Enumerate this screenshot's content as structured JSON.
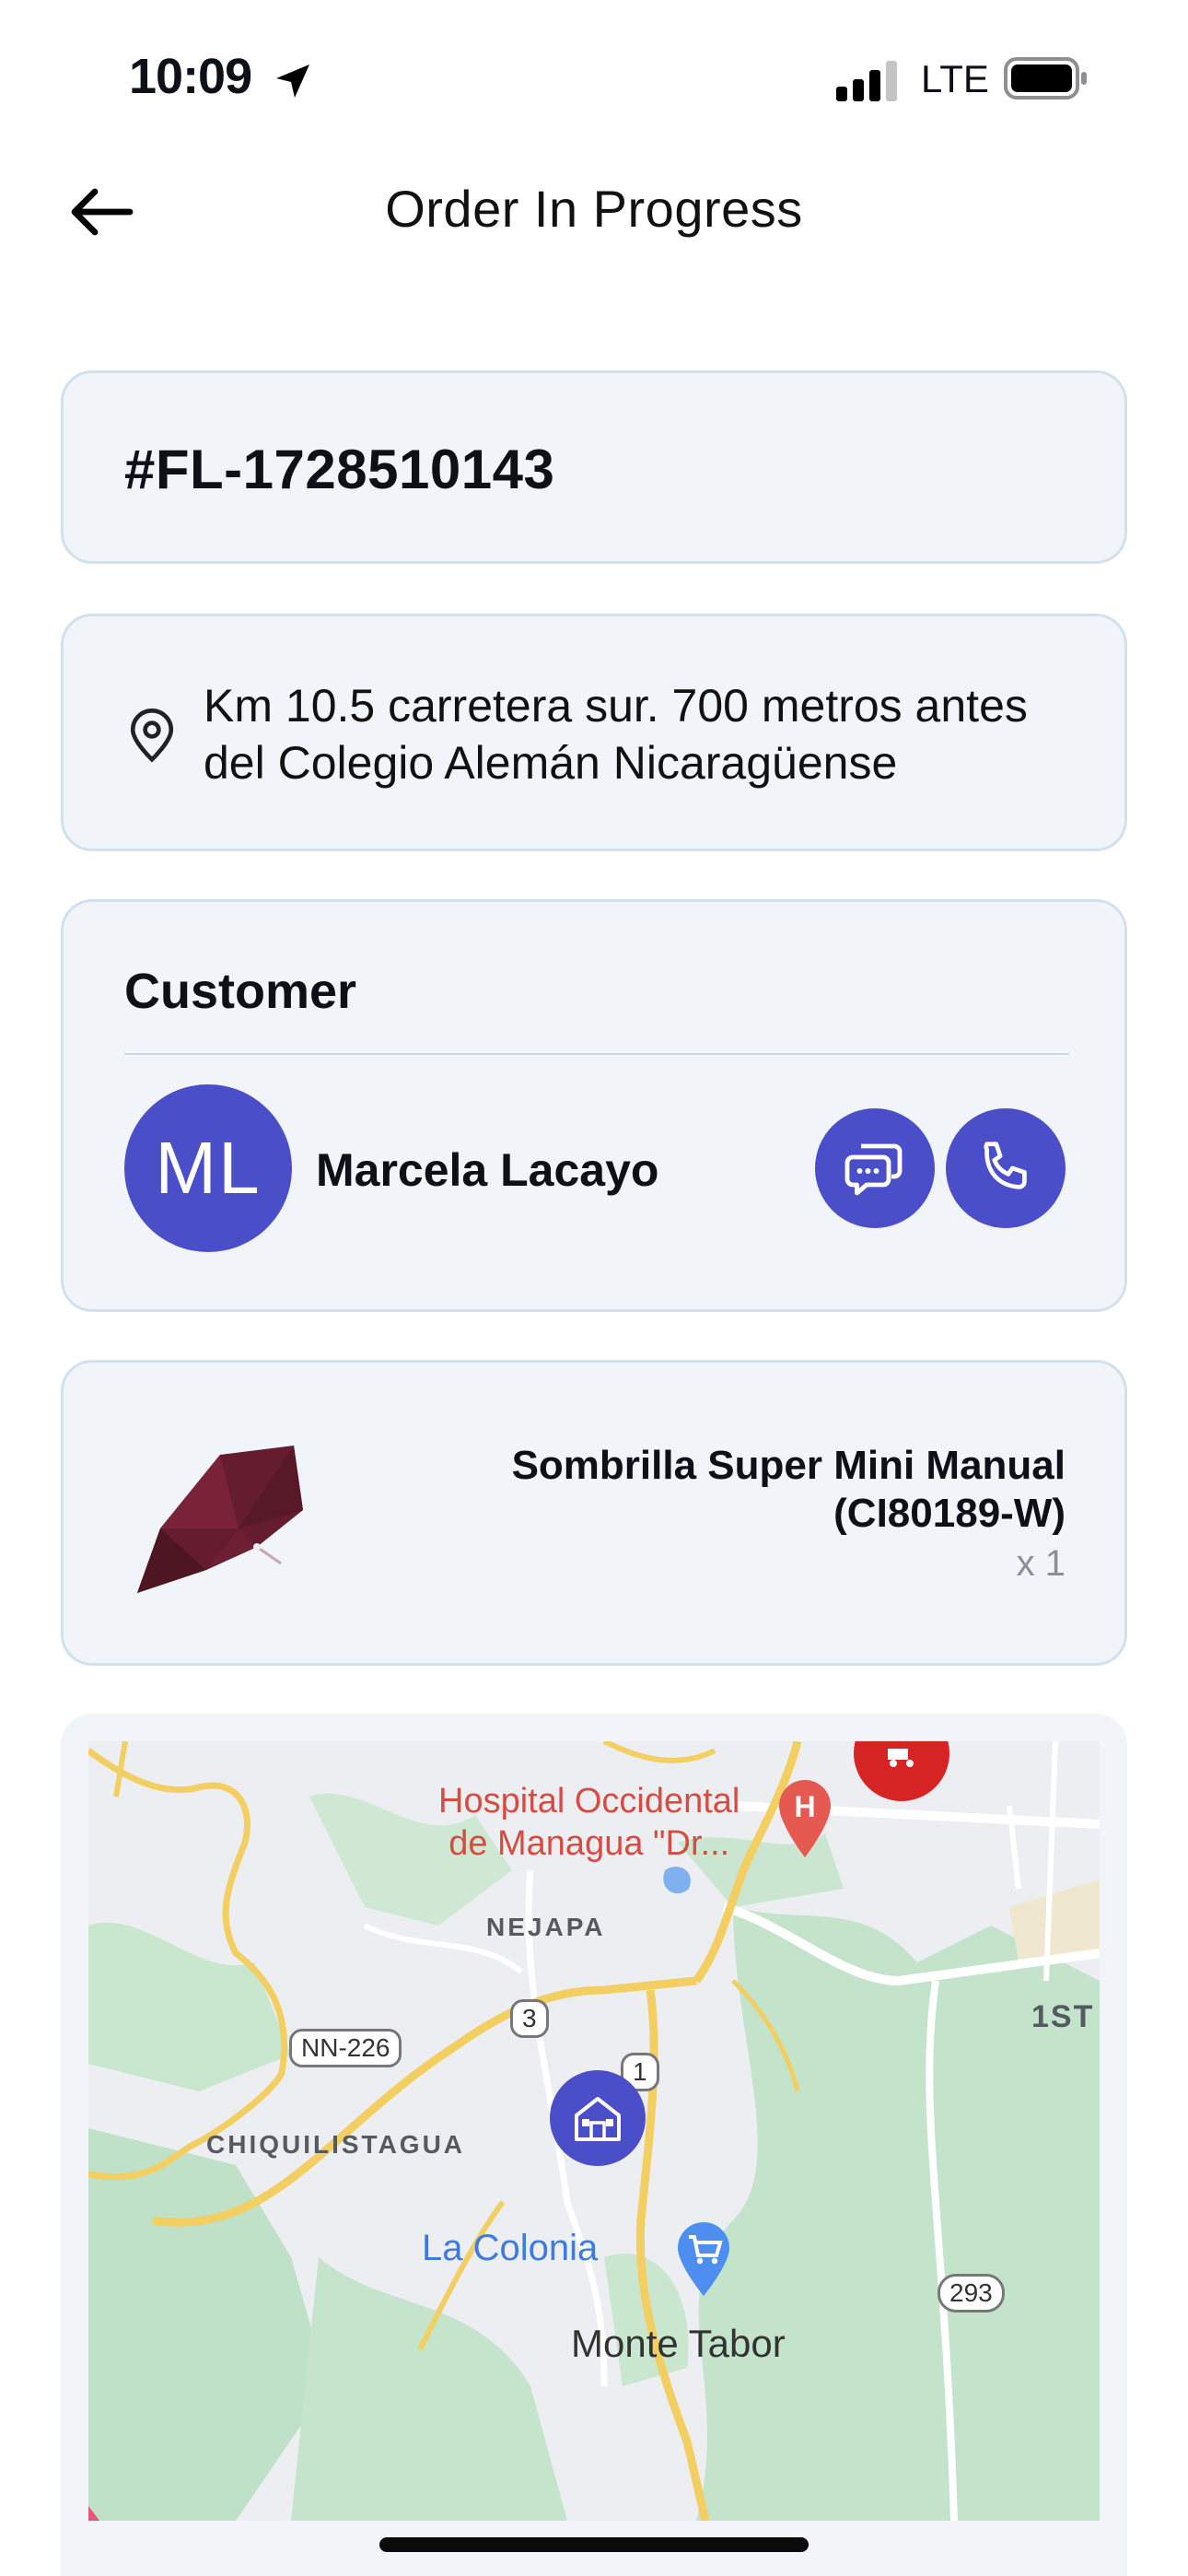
{
  "status_bar": {
    "time": "10:09",
    "network": "LTE",
    "icons": [
      "location-arrow-icon",
      "signal-icon",
      "battery-icon"
    ]
  },
  "header": {
    "title": "Order In Progress",
    "back_icon": "arrow-left-icon"
  },
  "order": {
    "number": "#FL-1728510143"
  },
  "address": {
    "line1": "Km 10.5 carretera sur. 700 metros antes",
    "line2": "del Colegio Alemán Nicaragüense",
    "icon": "map-pin-icon"
  },
  "customer": {
    "section_title": "Customer",
    "initials": "ML",
    "name": "Marcela Lacayo",
    "actions": [
      "chat-icon",
      "phone-icon"
    ]
  },
  "product": {
    "name": "Sombrilla Super Mini Manual (CI80189-W)",
    "quantity": "x 1"
  },
  "map": {
    "labels": {
      "hospital_line1": "Hospital Occidental",
      "hospital_line2": "de Managua \"Dr...",
      "nejapa": "NEJAPA",
      "chiquilistagua": "CHIQUILISTAGUA",
      "la_colonia": "La Colonia",
      "monte_tabor": "Monte Tabor",
      "first": "1ST",
      "route_nn226": "NN-226",
      "route_293": "293",
      "route_3": "3",
      "route_1": "1"
    },
    "markers": [
      "hospital-marker-icon",
      "delivery-marker-icon",
      "store-marker-icon",
      "shopping-cart-marker-icon"
    ]
  },
  "colors": {
    "accent": "#4b4ec9",
    "card_bg": "#f1f4f9",
    "card_border": "#d3e1ee"
  }
}
